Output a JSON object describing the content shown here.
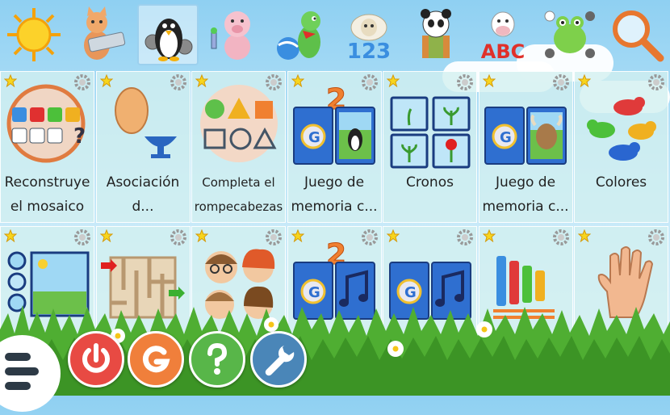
{
  "categories": [
    {
      "name": "sun-category-icon"
    },
    {
      "name": "cat-keyboard-category-icon"
    },
    {
      "name": "penguin-gears-category-icon",
      "selected": true
    },
    {
      "name": "pig-scientist-category-icon"
    },
    {
      "name": "dinosaur-ball-category-icon"
    },
    {
      "name": "sheep-numbers-category-icon",
      "text": "123"
    },
    {
      "name": "panda-puzzle-category-icon"
    },
    {
      "name": "cow-letters-category-icon",
      "text": "ABC"
    },
    {
      "name": "frog-board-category-icon"
    },
    {
      "name": "magnifier-search-icon"
    }
  ],
  "activities": [
    {
      "label_lines": [
        "Reconstruye",
        "el mosaico"
      ]
    },
    {
      "label_lines": [
        "Asociación",
        "d..."
      ]
    },
    {
      "label_lines": [
        "Completa el",
        "rompecabezas"
      ],
      "small": true
    },
    {
      "label_lines": [
        "Juego de",
        "memoria c..."
      ],
      "badge": "2"
    },
    {
      "label_lines": [
        "Cronos"
      ]
    },
    {
      "label_lines": [
        "Juego de",
        "memoria c..."
      ]
    },
    {
      "label_lines": [
        "Colores"
      ]
    },
    {
      "label_lines": []
    },
    {
      "label_lines": []
    },
    {
      "label_lines": []
    },
    {
      "label_lines": [],
      "badge": "2"
    },
    {
      "label_lines": []
    },
    {
      "label_lines": []
    },
    {
      "label_lines": []
    }
  ],
  "colors": {
    "exit": "#e84a43",
    "gcompris": "#f07f3b",
    "help": "#58b649",
    "settings": "#4a86b8",
    "star": "#f7d51d",
    "card_blue": "#2f6fd0"
  }
}
